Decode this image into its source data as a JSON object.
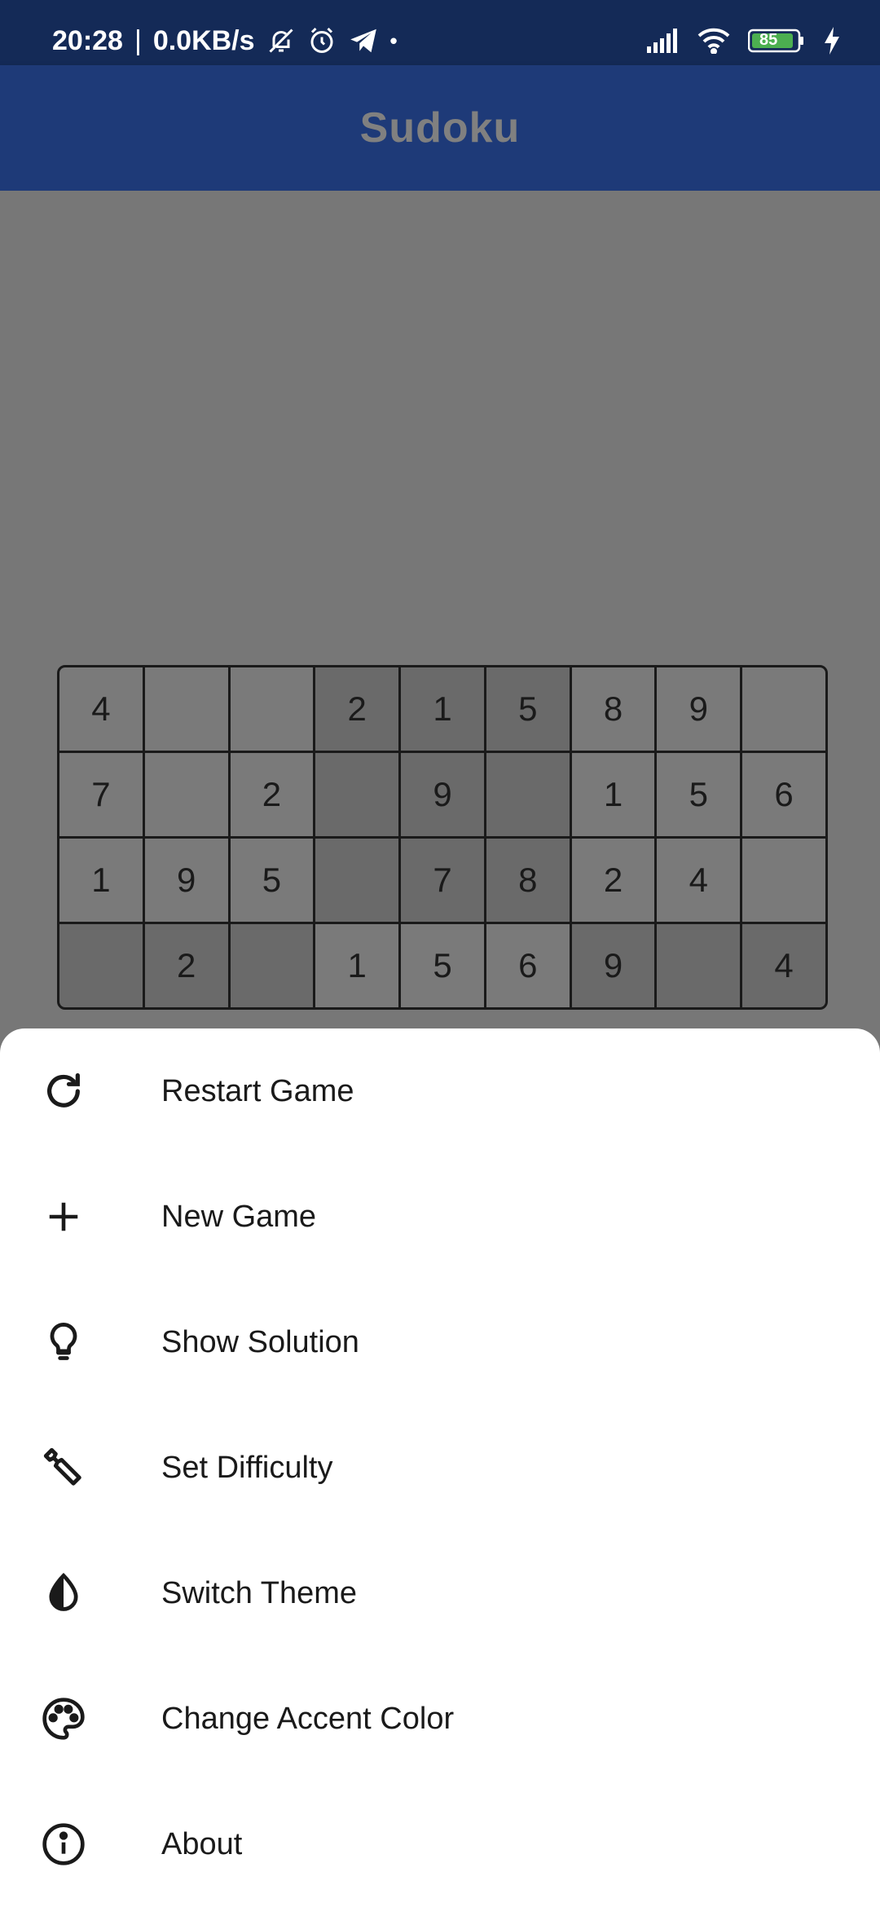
{
  "status_bar": {
    "time": "20:28",
    "separator": "|",
    "network_speed": "0.0KB/s",
    "battery": "85",
    "dot": "•"
  },
  "app_bar": {
    "title": "Sudoku"
  },
  "board": {
    "rows": [
      [
        "4",
        "",
        "",
        "2",
        "1",
        "5",
        "8",
        "9",
        ""
      ],
      [
        "7",
        "",
        "2",
        "",
        "9",
        "",
        "1",
        "5",
        "6"
      ],
      [
        "1",
        "9",
        "5",
        "",
        "7",
        "8",
        "2",
        "4",
        ""
      ],
      [
        "",
        "2",
        "",
        "1",
        "5",
        "6",
        "9",
        "",
        "4"
      ]
    ]
  },
  "menu": {
    "items": [
      {
        "label": "Restart Game",
        "icon": "restart-icon"
      },
      {
        "label": "New Game",
        "icon": "plus-icon"
      },
      {
        "label": "Show Solution",
        "icon": "lightbulb-icon"
      },
      {
        "label": "Set Difficulty",
        "icon": "wrench-icon"
      },
      {
        "label": "Switch Theme",
        "icon": "contrast-icon"
      },
      {
        "label": "Change Accent Color",
        "icon": "palette-icon"
      },
      {
        "label": "About",
        "icon": "info-icon"
      }
    ]
  },
  "colors": {
    "status_bar_bg": "#142a57",
    "app_bar_bg": "#1e3a78",
    "scrim": "#777777",
    "sheet_bg": "#ffffff",
    "battery_fill": "#4caf50"
  }
}
